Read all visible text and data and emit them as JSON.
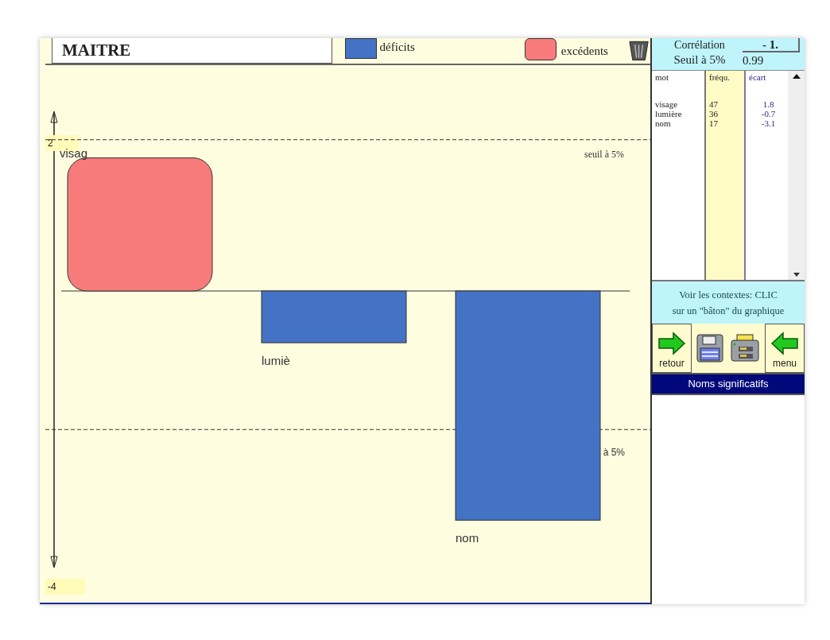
{
  "chart_header": {
    "title": "MAITRE",
    "legend": [
      {
        "label": "déficits",
        "color": "#4472c4"
      },
      {
        "label": "excédents",
        "color": "#f77b7b"
      }
    ]
  },
  "chart": {
    "chart_data": {
      "type": "bar",
      "categories": [
        "visag",
        "lumiè",
        "nom"
      ],
      "series": [
        {
          "values": [
            1.8,
            -0.7,
            -3.1
          ]
        }
      ],
      "ylim": [
        -4,
        2
      ],
      "yticks": [
        {
          "value": 2,
          "label": "2"
        },
        {
          "value": -4,
          "label": "-4"
        }
      ]
    },
    "thresholds": [
      {
        "label": "seuil à 5%"
      },
      {
        "label": "à 5%"
      }
    ]
  },
  "stats": {
    "correlation_label": "Corrélation",
    "correlation_value": "- 1.",
    "threshold_label": "Seuil à 5%",
    "threshold_value": "0.99"
  },
  "table": {
    "columns": [
      "mot",
      "fréqu.",
      "écart"
    ],
    "rows": [
      [
        "visage",
        "47",
        "1.8"
      ],
      [
        "lumière",
        "36",
        "-0.7"
      ],
      [
        "nom",
        "17",
        "-3.1"
      ]
    ]
  },
  "hint": [
    "Voir les contextes: CLIC",
    "sur un \"bâton\" du graphique"
  ],
  "buttons": [
    {
      "kind": "back",
      "label": "retour"
    },
    {
      "kind": "save"
    },
    {
      "kind": "print"
    },
    {
      "kind": "menu",
      "label": "menu"
    }
  ],
  "status_bar": "Noms significatifs"
}
